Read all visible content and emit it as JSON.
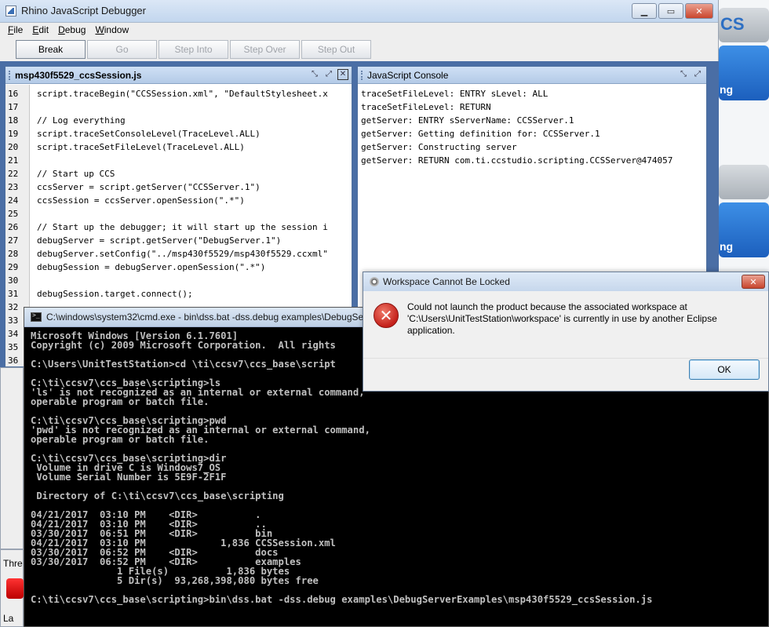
{
  "debugger": {
    "title": "Rhino JavaScript Debugger",
    "menu": [
      "File",
      "Edit",
      "Debug",
      "Window"
    ],
    "menu_mnemonic": [
      "F",
      "E",
      "D",
      "W"
    ],
    "toolbar": {
      "break": "Break",
      "go": "Go",
      "step_into": "Step Into",
      "step_over": "Step Over",
      "step_out": "Step Out"
    }
  },
  "script_frame": {
    "title": "msp430f5529_ccsSession.js",
    "lines": [
      {
        "n": "16",
        "text": "script.traceBegin(\"CCSSession.xml\", \"DefaultStylesheet.x"
      },
      {
        "n": "17",
        "text": ""
      },
      {
        "n": "18",
        "text": "// Log everything"
      },
      {
        "n": "19",
        "text": "script.traceSetConsoleLevel(TraceLevel.ALL)"
      },
      {
        "n": "20",
        "text": "script.traceSetFileLevel(TraceLevel.ALL)"
      },
      {
        "n": "21",
        "text": ""
      },
      {
        "n": "22",
        "text": "// Start up CCS"
      },
      {
        "n": "23",
        "text": "ccsServer = script.getServer(\"CCSServer.1\")"
      },
      {
        "n": "24",
        "text": "ccsSession = ccsServer.openSession(\".*\")"
      },
      {
        "n": "25",
        "text": ""
      },
      {
        "n": "26",
        "text": "// Start up the debugger; it will start up the session i"
      },
      {
        "n": "27",
        "text": "debugServer = script.getServer(\"DebugServer.1\")"
      },
      {
        "n": "28",
        "text": "debugServer.setConfig(\"../msp430f5529/msp430f5529.ccxml\""
      },
      {
        "n": "29",
        "text": "debugSession = debugServer.openSession(\".*\")"
      },
      {
        "n": "30",
        "text": ""
      },
      {
        "n": "31",
        "text": "debugSession.target.connect();"
      },
      {
        "n": "32",
        "text": ""
      },
      {
        "n": "33",
        "text": ""
      },
      {
        "n": "34",
        "text": ""
      },
      {
        "n": "35",
        "text": ""
      },
      {
        "n": "36",
        "text": ""
      }
    ]
  },
  "console_frame": {
    "title": "JavaScript Console",
    "lines": [
      "traceSetFileLevel: ENTRY sLevel: ALL",
      "traceSetFileLevel: RETURN",
      "getServer: ENTRY sServerName: CCSServer.1",
      "getServer: Getting definition for: CCSServer.1",
      "getServer: Constructing server",
      "getServer: RETURN com.ti.ccstudio.scripting.CCSServer@474057"
    ]
  },
  "left_remnant": {
    "thread_label": "Thre",
    "taskbar_label": "La"
  },
  "desktop_right": {
    "tile1_top": "CS",
    "tile1_label": "ng",
    "tile2_label": "ng"
  },
  "cmd": {
    "title": "C:\\windows\\system32\\cmd.exe - bin\\dss.bat  -dss.debug examples\\DebugSe",
    "lines": [
      "Microsoft Windows [Version 6.1.7601]",
      "Copyright (c) 2009 Microsoft Corporation.  All rights",
      "",
      "C:\\Users\\UnitTestStation>cd \\ti\\ccsv7\\ccs_base\\script",
      "",
      "C:\\ti\\ccsv7\\ccs_base\\scripting>ls",
      "'ls' is not recognized as an internal or external command,",
      "operable program or batch file.",
      "",
      "C:\\ti\\ccsv7\\ccs_base\\scripting>pwd",
      "'pwd' is not recognized as an internal or external command,",
      "operable program or batch file.",
      "",
      "C:\\ti\\ccsv7\\ccs_base\\scripting>dir",
      " Volume in drive C is Windows7_OS",
      " Volume Serial Number is 5E9F-2F1F",
      "",
      " Directory of C:\\ti\\ccsv7\\ccs_base\\scripting",
      "",
      "04/21/2017  03:10 PM    <DIR>          .",
      "04/21/2017  03:10 PM    <DIR>          ..",
      "03/30/2017  06:51 PM    <DIR>          bin",
      "04/21/2017  03:10 PM             1,836 CCSSession.xml",
      "03/30/2017  06:52 PM    <DIR>          docs",
      "03/30/2017  06:52 PM    <DIR>          examples",
      "               1 File(s)          1,836 bytes",
      "               5 Dir(s)  93,268,398,080 bytes free",
      "",
      "C:\\ti\\ccsv7\\ccs_base\\scripting>bin\\dss.bat -dss.debug examples\\DebugServerExamples\\msp430f5529_ccsSession.js"
    ]
  },
  "dialog": {
    "title": "Workspace Cannot Be Locked",
    "message": "Could not launch the product because the associated workspace at 'C:\\Users\\UnitTestStation\\workspace' is currently in use by another Eclipse application.",
    "ok": "OK"
  }
}
